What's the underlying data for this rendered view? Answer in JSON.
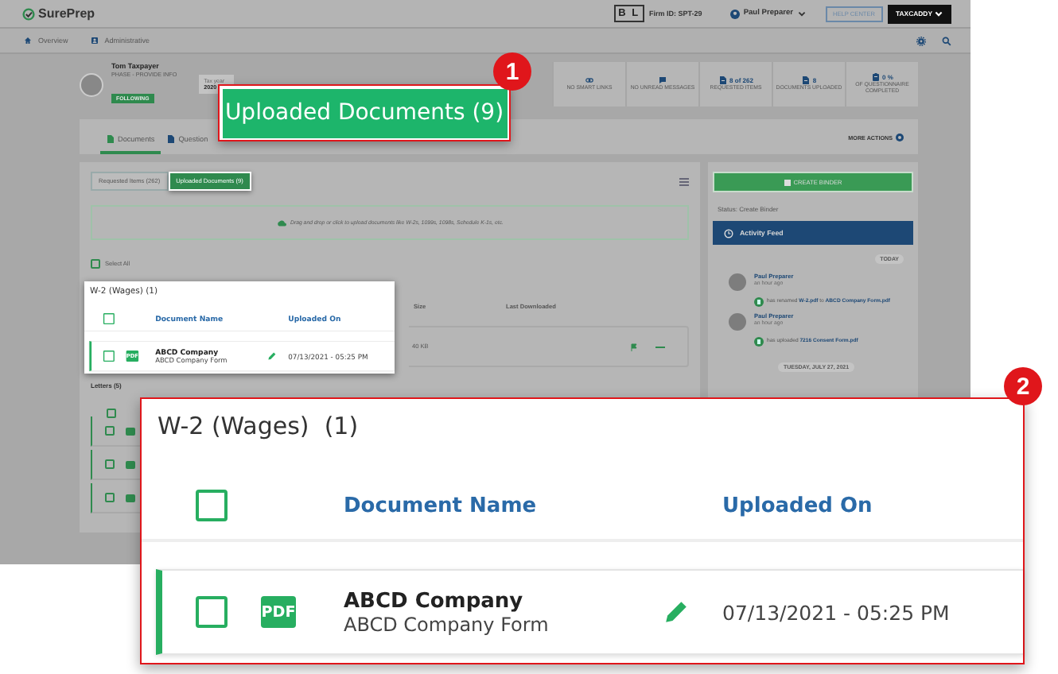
{
  "top_bar": {
    "logo": "SurePrep",
    "firm_badge": "B L",
    "firm_id": "Firm ID: SPT-29",
    "user": "Paul Preparer",
    "help_button": "HELP CENTER",
    "product_button": "TAXCADDY"
  },
  "nav": [
    {
      "label": "Overview",
      "kind": "home"
    },
    {
      "label": "Administrative",
      "kind": "person"
    }
  ],
  "client": {
    "name": "Tom Taxpayer",
    "phase": "PHASE - PROVIDE INFO",
    "follow_badge": "FOLLOWING",
    "tax_year_label": "Tax year",
    "tax_year": "2020"
  },
  "stats": [
    {
      "kind": "link",
      "label": "NO SMART LINKS"
    },
    {
      "kind": "message",
      "label": "NO UNREAD MESSAGES"
    },
    {
      "kind": "doc",
      "value": "8 of 262",
      "label": "REQUESTED ITEMS"
    },
    {
      "kind": "doc",
      "value": "8",
      "label": "DOCUMENTS UPLOADED"
    },
    {
      "kind": "clipboard",
      "value": "0 %",
      "label": "OF QUESTIONNAIRE COMPLETED"
    }
  ],
  "tabs": [
    {
      "label": "Documents",
      "selected": true
    },
    {
      "label": "Question",
      "selected": false
    }
  ],
  "more_actions": "MORE ACTIONS",
  "segments": [
    {
      "label": "Requested Items (262)",
      "selected": false
    },
    {
      "label": "Uploaded Documents (9)",
      "selected": true
    }
  ],
  "drop_zone": "Drag and drop or click to upload documents like W-2s, 1099s, 1098s, Schedule K-1s, etc.",
  "select_all": {
    "label": "Select All",
    "checked": false
  },
  "columns_behind": [
    "Size",
    "Last Downloaded"
  ],
  "row_behind": {
    "size": "40 KB"
  },
  "letters": {
    "title": "Letters (5)",
    "header_checked": false,
    "rows": [
      {
        "checked": false
      },
      {
        "checked": false
      },
      {
        "checked": false
      }
    ]
  },
  "side_panel": {
    "create_button": "CREATE BINDER",
    "status": "Status: Create Binder",
    "feed_title": "Activity Feed",
    "feed": [
      {
        "kind": "day",
        "label": "TODAY"
      },
      {
        "kind": "entry",
        "user": "Paul Preparer",
        "time": "an hour ago",
        "text": "has renamed **W-2.pdf** to **ABCD Company Form.pdf**"
      },
      {
        "kind": "entry",
        "user": "Paul Preparer",
        "time": "an hour ago",
        "text": "has uploaded **7216 Consent Form.pdf**"
      },
      {
        "kind": "day",
        "label": "TUESDAY, JULY 27, 2021"
      }
    ]
  },
  "highlight_card": {
    "group": "W-2 (Wages) (1)",
    "columns": [
      "Document Name",
      "Uploaded On"
    ],
    "header_checked": false,
    "row": {
      "checked": false,
      "icon": "PDF",
      "name": "ABCD Company",
      "subtitle": "ABCD Company Form",
      "uploaded": "07/13/2021 - 05:25 PM"
    }
  },
  "callout_1": {
    "number": "1",
    "label": "Uploaded Documents (9)"
  },
  "callout_2": {
    "number": "2",
    "group": "W-2 (Wages)  (1)",
    "columns": [
      "Document Name",
      "Uploaded On"
    ],
    "header_checked": false,
    "row": {
      "checked": false,
      "icon": "PDF",
      "name": "ABCD Company",
      "subtitle": "ABCD Company Form",
      "uploaded": "07/13/2021 - 05:25 PM"
    }
  }
}
